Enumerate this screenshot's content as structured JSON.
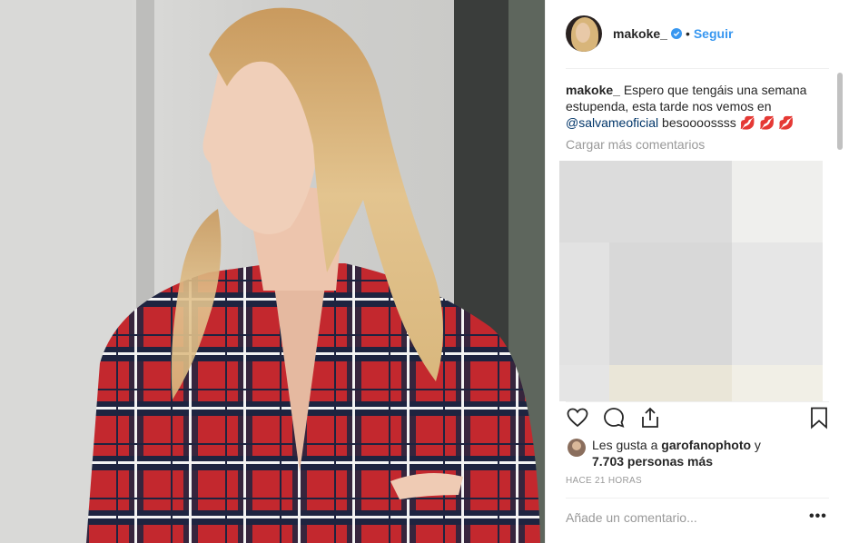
{
  "post": {
    "username": "makoke_",
    "separator": "•",
    "follow_label": "Seguir",
    "caption_user": "makoke_",
    "caption_text_1": " Espero que tengáis una semana estupenda, esta tarde nos vemos en ",
    "caption_mention": "@salvameoficial",
    "caption_text_2": " besoooossss ",
    "caption_emojis": "💋 💋 💋",
    "load_more": "Cargar más comentarios",
    "likes_prefix": "Les gusta a ",
    "likes_user": "garofanophoto",
    "likes_middle": " y",
    "likes_count": "7.703 personas más",
    "timestamp": "HACE 21 HORAS",
    "comment_placeholder": "Añade un comentario...",
    "more_label": "•••"
  },
  "colors": {
    "accent": "#3897f0",
    "mention": "#003569",
    "muted": "#999999",
    "text": "#262626"
  },
  "icons": [
    "verified-badge-icon",
    "heart-icon",
    "comment-icon",
    "share-icon",
    "bookmark-icon",
    "more-options-icon"
  ]
}
